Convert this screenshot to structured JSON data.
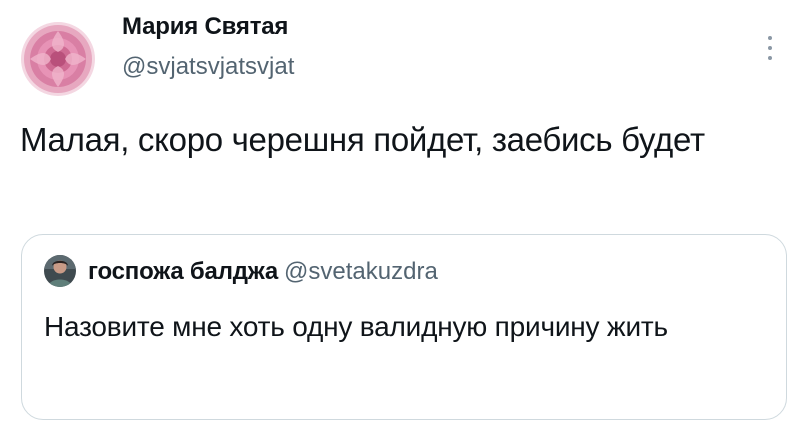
{
  "tweet": {
    "author_name": "Мария Святая",
    "author_handle": "@svjatsvjatsvjat",
    "text": "Малая, скоро черешня пойдет, заебись будет",
    "avatar_icon": "pink-flower-avatar",
    "more_icon": "vertical-dots-icon"
  },
  "quoted_tweet": {
    "author_name": "госпожа балджа",
    "author_handle": "@svetakuzdra",
    "text": "Назовите мне хоть одну валидную причину жить",
    "avatar_icon": "person-photo-avatar"
  },
  "colors": {
    "text_primary": "#0f1419",
    "text_secondary": "#536471",
    "border": "#cfd9de"
  }
}
